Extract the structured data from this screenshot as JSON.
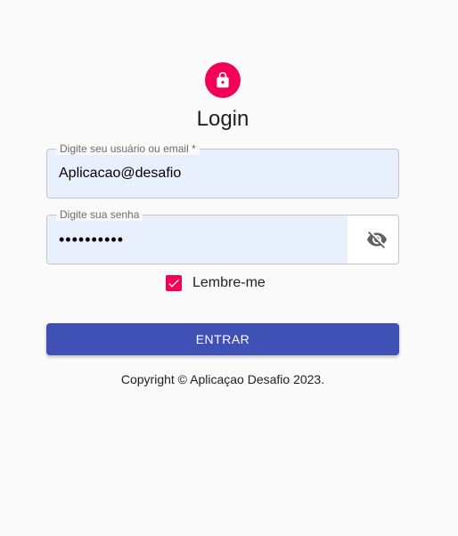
{
  "header": {
    "icon": "lock-icon",
    "title": "Login"
  },
  "form": {
    "email": {
      "label": "Digite seu usuário ou email *",
      "value": "Aplicacao@desafio"
    },
    "password": {
      "label": "Digite sua senha",
      "value": "••••••••••",
      "toggle_icon": "eye-off-icon"
    },
    "remember": {
      "label": "Lembre-me",
      "checked": true
    },
    "submit_label": "ENTRAR"
  },
  "footer": {
    "copyright": "Copyright © Aplicaçao Desafio 2023."
  },
  "colors": {
    "accent": "#f50057",
    "primary": "#3f51b5",
    "autofill": "#e8f0fe"
  }
}
